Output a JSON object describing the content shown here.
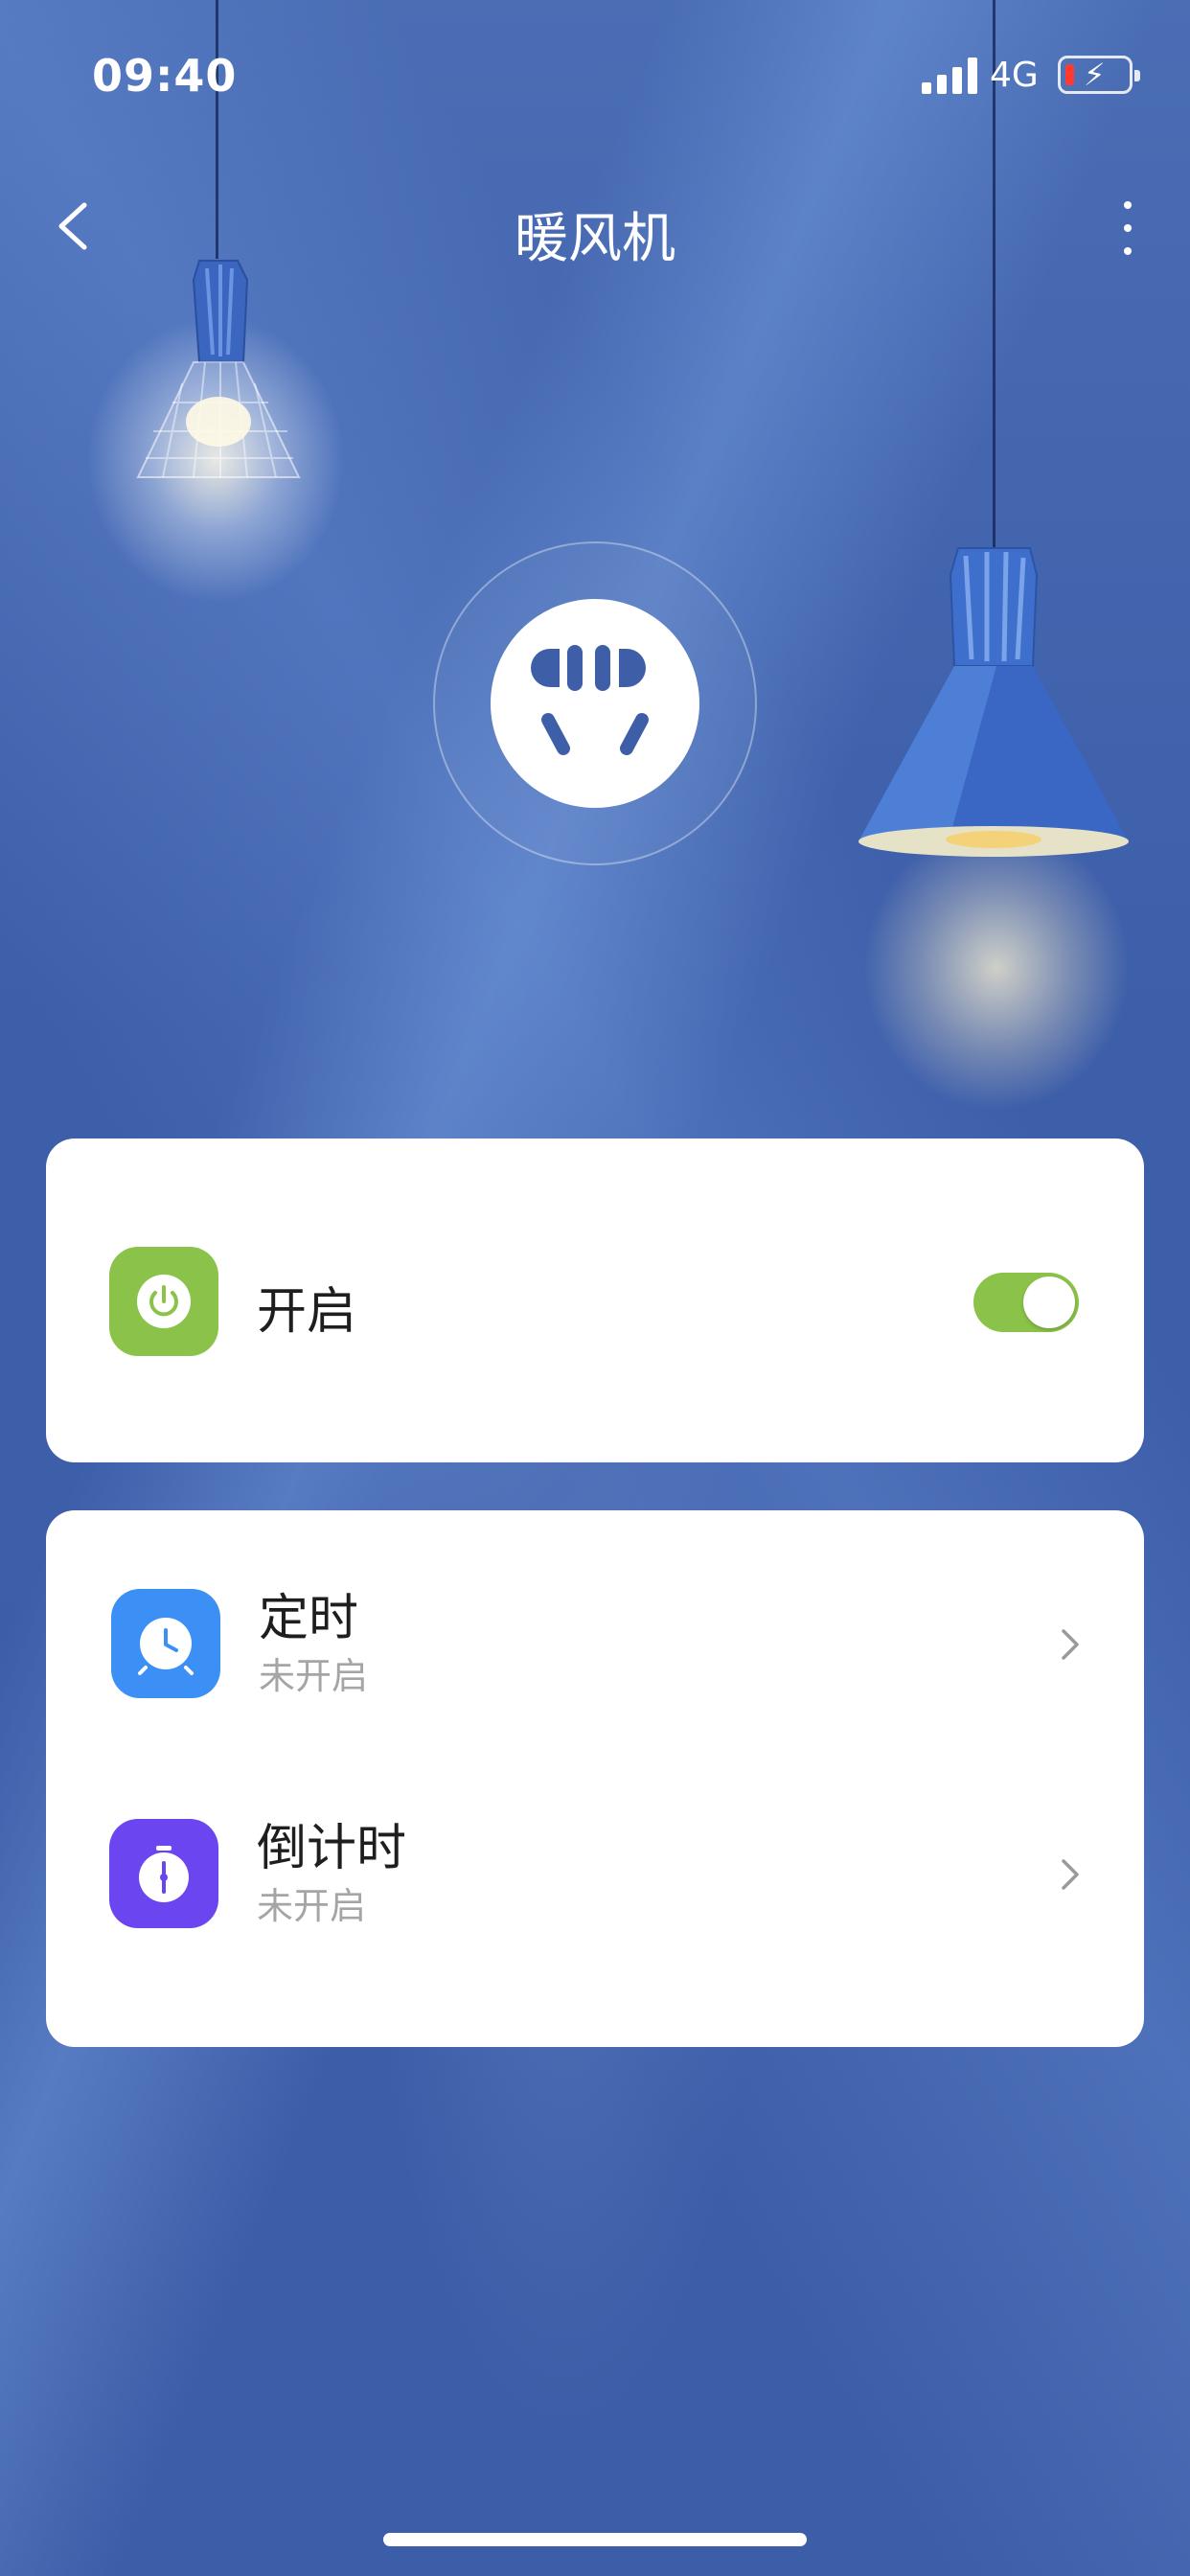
{
  "status_bar": {
    "time": "09:40",
    "network": "4G",
    "battery_color": "#ff3b30"
  },
  "header": {
    "title": "暖风机",
    "back_icon": "chevron-left-icon",
    "more_icon": "more-vertical-icon"
  },
  "device": {
    "icon": "power-socket-icon"
  },
  "power_card": {
    "label": "开启",
    "icon": "power-icon",
    "icon_color": "#8bc34a",
    "toggle_on": true
  },
  "timer_card": {
    "items": [
      {
        "label": "定时",
        "status": "未开启",
        "icon": "alarm-clock-icon",
        "icon_color": "#3b8ff5"
      },
      {
        "label": "倒计时",
        "status": "未开启",
        "icon": "stopwatch-icon",
        "icon_color": "#6a45f0"
      }
    ]
  },
  "colors": {
    "background": "#3e5fa8",
    "accent_green": "#8bc34a",
    "secondary_text": "#a5a5a5"
  }
}
